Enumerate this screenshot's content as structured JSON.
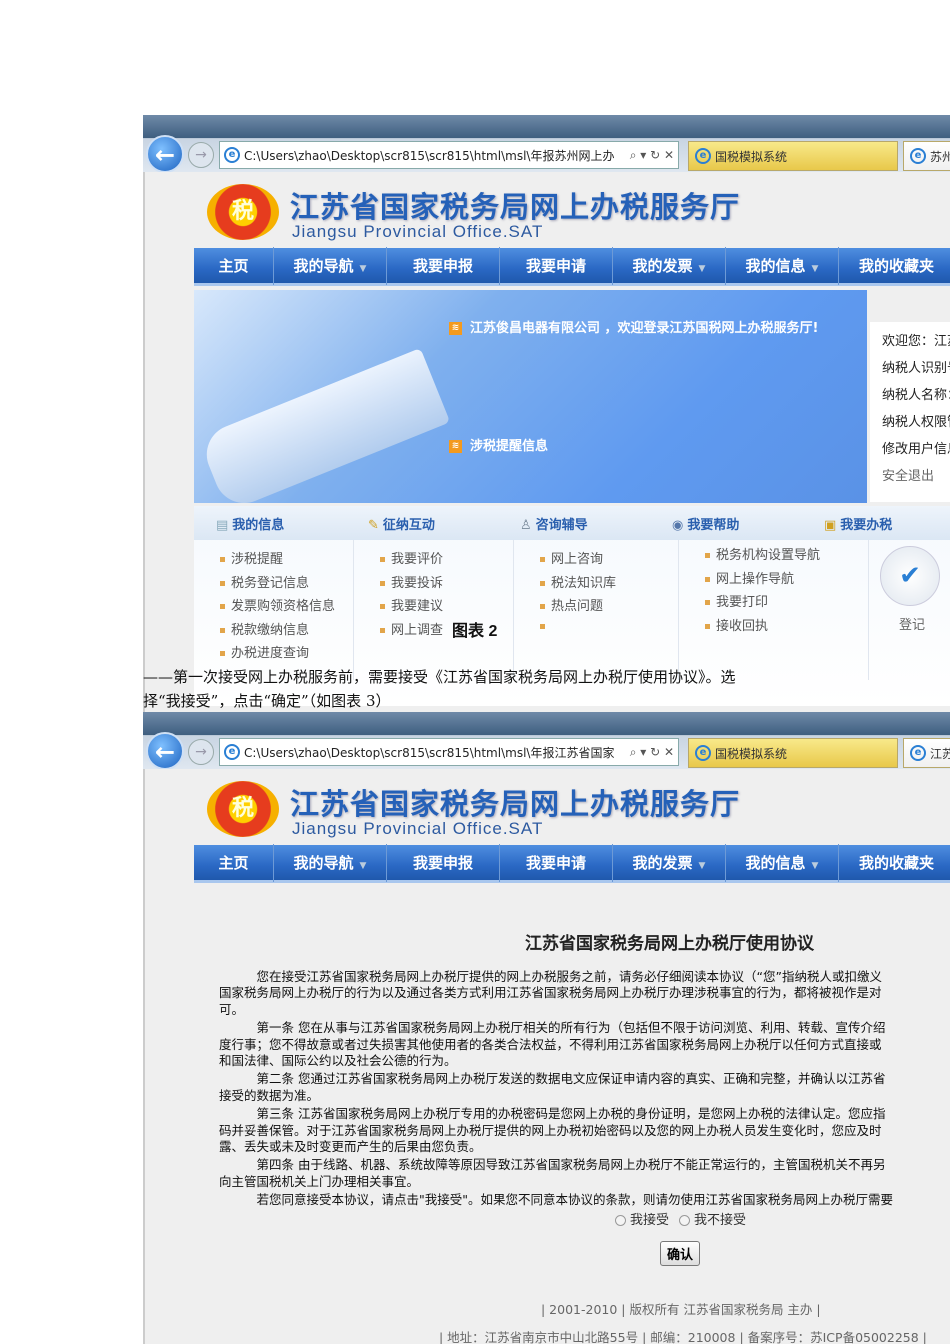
{
  "screenshot1": {
    "address": "C:\\Users\\zhao\\Desktop\\scr815\\scr815\\html\\msl\\年报苏州网上办",
    "tabs": [
      "国税模拟系统",
      "苏州"
    ],
    "site_title": "江苏省国家税务局网上办税服务厅",
    "site_subtitle": "Jiangsu Provincial Office.SAT",
    "logo_text": "税",
    "nav": [
      "主页",
      "我的导航",
      "我要申报",
      "我要申请",
      "我的发票",
      "我的信息",
      "我的收藏夹"
    ],
    "welcome": "江苏俊昌电器有限公司 ，欢迎登录江苏国税网上办税服务厅!",
    "reminder": "涉税提醒信息",
    "user_panel": [
      "欢迎您：江苏",
      "纳税人识别号",
      "纳税人名称：",
      "纳税人权限管",
      "修改用户信息",
      "安全退出"
    ],
    "quick_heads": [
      "我的信息",
      "征纳互动",
      "咨询辅导",
      "我要帮助",
      "我要办税"
    ],
    "quick_cols": [
      [
        "涉税提醒",
        "税务登记信息",
        "发票购领资格信息",
        "税款缴纳信息",
        "办税进度查询"
      ],
      [
        "我要评价",
        "我要投诉",
        "我要建议",
        "网上调查"
      ],
      [
        "网上咨询",
        "税法知识库",
        "热点问题",
        ""
      ],
      [
        "税务机构设置导航",
        "网上操作导航",
        "我要打印",
        "接收回执"
      ]
    ],
    "register_label": "登记",
    "banshui_label": "办税"
  },
  "caption": "图表 2",
  "instruction_line1": "——第一次接受网上办税服务前，需要接受《江苏省国家税务局网上办税厅使用协议》。选",
  "instruction_line2": "择“我接受”，点击“确定”（如图表 3）",
  "screenshot2": {
    "address": "C:\\Users\\zhao\\Desktop\\scr815\\scr815\\html\\msl\\年报江苏省国家",
    "tabs": [
      "国税模拟系统",
      "江苏"
    ],
    "doc_title": "江苏省国家税务局网上办税厅使用协议",
    "agreement_lines": [
      "　　　您在接受江苏省国家税务局网上办税厅提供的网上办税服务之前，请务必仔细阅读本协议（“您”指纳税人或扣缴义",
      "国家税务局网上办税厅的行为以及通过各类方式利用江苏省国家税务局网上办税厅办理涉税事宜的行为，都将被视作是对",
      "可。",
      "　　　第一条  您在从事与江苏省国家税务局网上办税厅相关的所有行为（包括但不限于访问浏览、利用、转载、宣传介绍",
      "度行事；您不得故意或者过失损害其他使用者的各类合法权益，不得利用江苏省国家税务局网上办税厅以任何方式直接或",
      "和国法律、国际公约以及社会公德的行为。",
      "　　　第二条  您通过江苏省国家税务局网上办税厅发送的数据电文应保证申请内容的真实、正确和完整，并确认以江苏省",
      "接受的数据为准。",
      "　　　第三条  江苏省国家税务局网上办税厅专用的办税密码是您网上办税的身份证明，是您网上办税的法律认定。您应指",
      "码并妥善保管。对于江苏省国家税务局网上办税厅提供的网上办税初始密码以及您的网上办税人员发生变化时，您应及时",
      "露、丢失或未及时变更而产生的后果由您负责。",
      "　　　第四条  由于线路、机器、系统故障等原因导致江苏省国家税务局网上办税厅不能正常运行的，主管国税机关不再另",
      "向主管国税机关上门办理相关事宜。",
      "　　　若您同意接受本协议，请点击\"我接受\"。如果您不同意本协议的条款，则请勿使用江苏省国家税务局网上办税厅需要"
    ],
    "accept_label": "我接受",
    "reject_label": "我不接受",
    "confirm_label": "确认",
    "footer1": "| 2001-2010 | 版权所有  江苏省国家税务局  主办  |",
    "footer2": "| 地址：江苏省南京市中山北路55号 | 邮编：210008 | 备案序号：苏ICP备05002258 |"
  }
}
